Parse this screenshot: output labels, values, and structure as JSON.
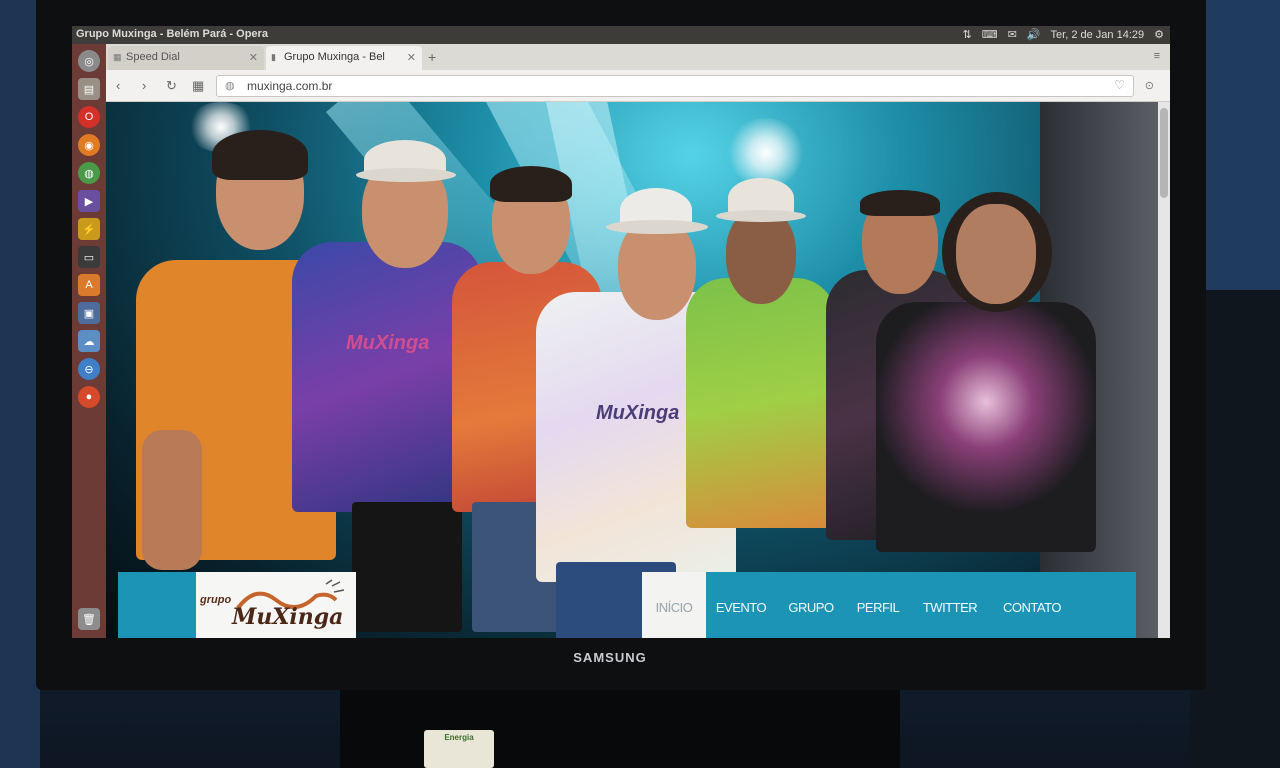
{
  "os": {
    "window_title": "Grupo Muxinga - Belém Pará - Opera",
    "clock": "Ter, 2 de Jan 14:29",
    "tray_icons": [
      "network-icon",
      "keyboard-icon",
      "mail-icon",
      "volume-icon",
      "gear-icon"
    ],
    "launcher_icons": [
      "search-icon",
      "files-icon",
      "opera-icon",
      "firefox-icon",
      "chrome-icon",
      "video-icon",
      "flash-icon",
      "terminal-icon",
      "software-center-icon",
      "image-viewer-icon",
      "cloud-icon",
      "browser-icon",
      "opera-red-icon",
      "trash-icon"
    ]
  },
  "browser": {
    "tabs": [
      {
        "label": "Speed Dial",
        "active": false
      },
      {
        "label": "Grupo Muxinga - Bel",
        "active": true
      }
    ],
    "address": "muxinga.com.br"
  },
  "site": {
    "logo_small": "grupo",
    "logo_big": "MuXinga",
    "nav": [
      {
        "label": "INÍCIO",
        "active": true
      },
      {
        "label": "EVENTO",
        "active": false
      },
      {
        "label": "GRUPO",
        "active": false
      },
      {
        "label": "PERFIL",
        "active": false
      },
      {
        "label": "TWITTER",
        "active": false
      },
      {
        "label": "CONTATO",
        "active": false
      }
    ],
    "shirt_print": "MuXinga"
  },
  "device": {
    "brand": "SAMSUNG",
    "sticker": "Energia"
  }
}
